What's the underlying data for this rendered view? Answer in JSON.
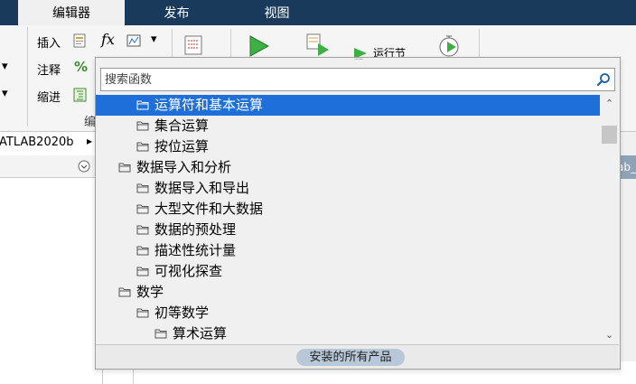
{
  "tabs": [
    {
      "label": "编辑器",
      "active": true
    },
    {
      "label": "发布",
      "active": false
    },
    {
      "label": "视图",
      "active": false
    }
  ],
  "ribbon": {
    "insert_label": "插入",
    "comment_label": "注释",
    "comment_percent": "%",
    "indent_label": "缩进",
    "fx_label": "fx",
    "run_partial_text": "运行节",
    "group_partial": "编"
  },
  "address_partial": "ATLAB2020b",
  "right_fragment": "ab_",
  "search": {
    "placeholder": "搜索函数"
  },
  "tree": [
    {
      "label": "运算符和基本运算",
      "level": 2,
      "selected": true
    },
    {
      "label": "集合运算",
      "level": 2,
      "selected": false
    },
    {
      "label": "按位运算",
      "level": 2,
      "selected": false
    },
    {
      "label": "数据导入和分析",
      "level": 1,
      "selected": false
    },
    {
      "label": "数据导入和导出",
      "level": 2,
      "selected": false
    },
    {
      "label": "大型文件和大数据",
      "level": 2,
      "selected": false
    },
    {
      "label": "数据的预处理",
      "level": 2,
      "selected": false
    },
    {
      "label": "描述性统计量",
      "level": 2,
      "selected": false
    },
    {
      "label": "可视化探查",
      "level": 2,
      "selected": false
    },
    {
      "label": "数学",
      "level": 1,
      "selected": false
    },
    {
      "label": "初等数学",
      "level": 2,
      "selected": false
    },
    {
      "label": "算术运算",
      "level": 3,
      "selected": false
    }
  ],
  "footer_label": "安装的所有产品",
  "colors": {
    "accent": "#1e6fd9",
    "tabbar": "#1a3a5c",
    "pill": "#b8c8d8"
  }
}
